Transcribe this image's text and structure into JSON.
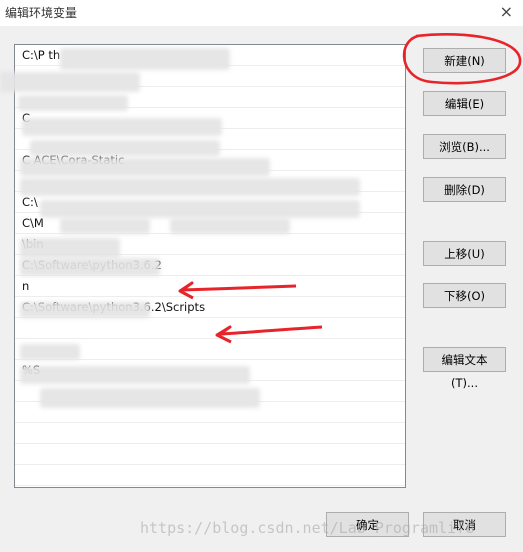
{
  "window": {
    "title": "编辑环境变量",
    "close_glyph": "×"
  },
  "path_list": {
    "rows": [
      "C:\\P                                        th",
      "",
      "",
      "C",
      "",
      "C                                                     ACE\\Cora-Static",
      "",
      "C:\\",
      "                              C\\M",
      "         \\bin",
      "C:\\Software\\python3.6.2",
      "                        n",
      "C:\\Software\\python3.6.2\\Scripts",
      "",
      "",
      "%S",
      "",
      "",
      "",
      "",
      ""
    ]
  },
  "buttons": {
    "new": "新建(N)",
    "edit": "编辑(E)",
    "browse": "浏览(B)...",
    "delete": "删除(D)",
    "move_up": "上移(U)",
    "move_down": "下移(O)",
    "edit_text": "编辑文本(T)...",
    "ok": "确定",
    "cancel": "取消"
  },
  "annotations": {
    "color": "#e8242b"
  },
  "watermark": "https://blog.csdn.net/Lab_Programlife"
}
